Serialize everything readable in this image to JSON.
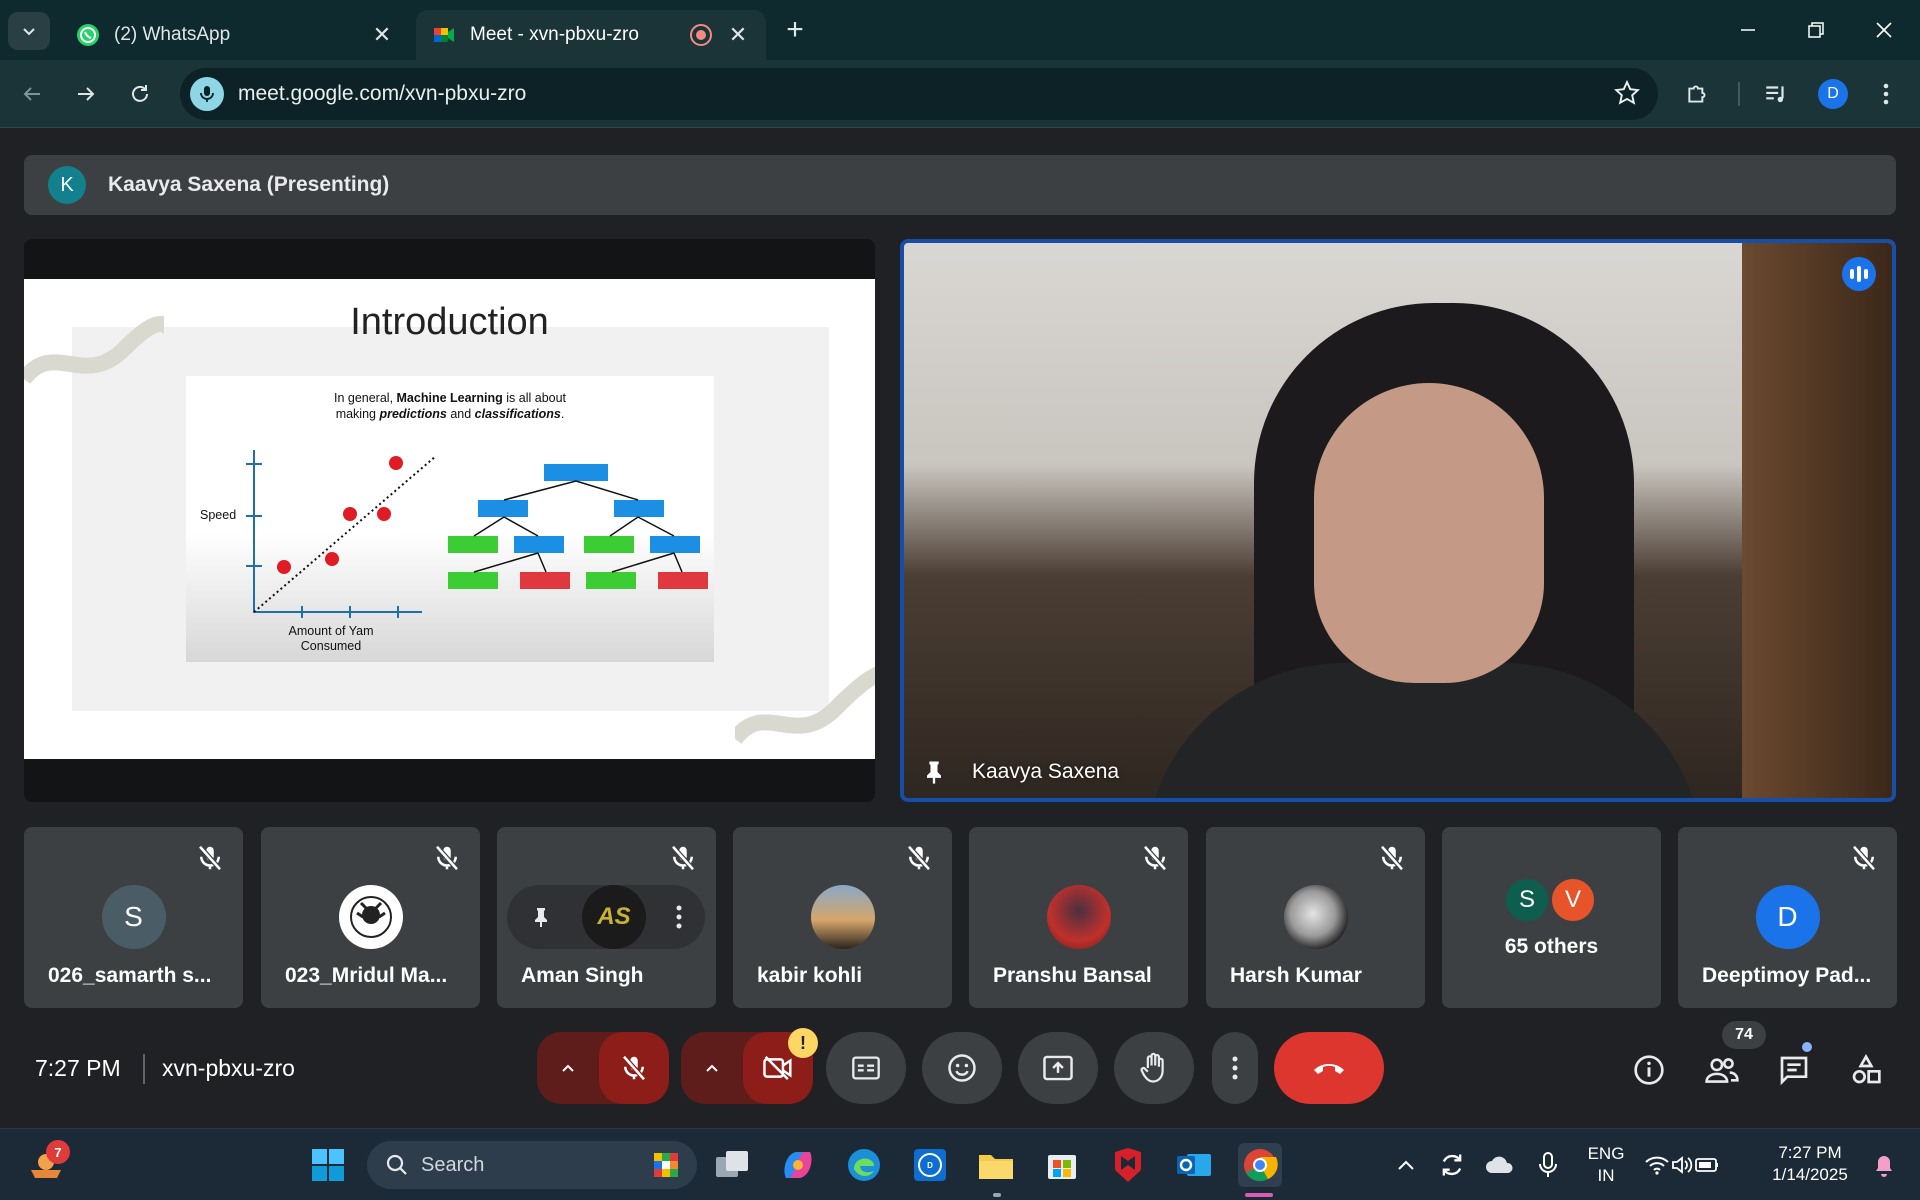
{
  "browser": {
    "tabs": [
      {
        "title": "(2) WhatsApp",
        "icon": "whatsapp-icon",
        "active": false
      },
      {
        "title": "Meet - xvn-pbxu-zro",
        "icon": "google-meet-icon",
        "active": true,
        "recording": true
      }
    ],
    "url": "meet.google.com/xvn-pbxu-zro",
    "profile_initial": "D"
  },
  "meet": {
    "presenter_initial": "K",
    "presenting_label": "Kaavya Saxena (Presenting)",
    "slide": {
      "title": "Introduction",
      "caption_line1_pre": "In general, ",
      "caption_line1_bold": "Machine Learning",
      "caption_line1_post": " is all about",
      "caption_line2_pre": "making ",
      "caption_predictions": "predictions",
      "caption_and": " and ",
      "caption_classifications": "classifications",
      "caption_end": ".",
      "y_label": "Speed",
      "x_label_line1": "Amount of Yam",
      "x_label_line2": "Consumed"
    },
    "main_video_name": "Kaavya Saxena",
    "participants": [
      {
        "name": "026_samarth s...",
        "initial": "S",
        "avatar_color": "#4a5d66",
        "muted": true
      },
      {
        "name": "023_Mridul Ma...",
        "avatar": "lion-logo",
        "muted": true
      },
      {
        "name": "Aman Singh",
        "avatar_text": "AS",
        "muted": true
      },
      {
        "name": "kabir kohli",
        "avatar": "photo",
        "muted": true
      },
      {
        "name": "Pranshu Bansal",
        "avatar": "photo",
        "muted": true
      },
      {
        "name": "Harsh Kumar",
        "avatar": "photo",
        "muted": true
      },
      {
        "others_label": "65 others",
        "initials": [
          "S",
          "V"
        ],
        "colors": [
          "#0e5e4f",
          "#e8542a"
        ]
      },
      {
        "name": "Deeptimoy Pad...",
        "initial": "D",
        "avatar_color": "#1a73e8",
        "muted": true
      }
    ],
    "time": "7:27 PM",
    "meeting_code": "xvn-pbxu-zro",
    "participant_count": "74",
    "warning_symbol": "!"
  },
  "taskbar": {
    "search_placeholder": "Search",
    "notification_count": "7",
    "lang_line1": "ENG",
    "lang_line2": "IN",
    "clock_time": "7:27 PM",
    "clock_date": "1/14/2025"
  },
  "colors": {
    "meet_bg": "#202124",
    "tile_bg": "#3c4043",
    "hangup_red": "#dc362e",
    "active_border": "#174ea6"
  }
}
